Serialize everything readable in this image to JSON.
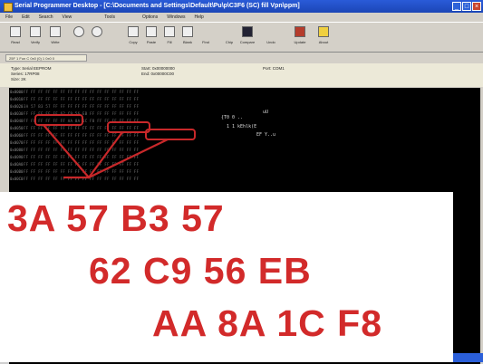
{
  "window": {
    "title": "Serial Programmer Desktop - [C:\\Documents and Settings\\Default\\Pu\\p\\C3F6 (SC) fill Vpn\\ppm]"
  },
  "menu": [
    "File",
    "Edit",
    "Search",
    "View",
    "Tools",
    "Options",
    "Windows",
    "Help"
  ],
  "toolbar": {
    "buttons": [
      "Read",
      "Verify",
      "Write",
      "Zoom",
      "Zoom",
      "Copy",
      "Paste",
      "Fill",
      "Blank",
      "Find",
      "Chip",
      "Compare",
      "Undo",
      "Update",
      "About"
    ]
  },
  "tab": {
    "label": "25F 1 Fun C 0x0 (0) 1 0x0 0"
  },
  "device": {
    "type": "Type: Serial EEPROM",
    "series": "Series: 17RP08",
    "size": "Size: 2K",
    "start": "Start: 0x00000000",
    "end": "End: 0x00000C00",
    "port": "Port: COM1"
  },
  "hex_rows": [
    {
      "addr": "0x0000",
      "bytes": "FF FF FF FF FF FF FF FF FF FF FF FF FF FF FF FF"
    },
    {
      "addr": "0x0010",
      "bytes": "FF FF FF FF FF FF FF FF FF FF FF FF FF FF FF FF"
    },
    {
      "addr": "0x0020",
      "bytes": "3A 57 B3 57 FF FF FF FF FF FF FF FF FF FF FF FF"
    },
    {
      "addr": "0x0030",
      "bytes": "FF FF FF FF FF 62 C9 56 EB FF FF FF FF FF FF FF"
    },
    {
      "addr": "0x0040",
      "bytes": "FF FF FF FF FF FF AA 8A 1C F8 FF FF FF FF FF FF"
    },
    {
      "addr": "0x0050",
      "bytes": "FF FF FF FF FF FF FF FF FF FF FF FF FF FF FF FF"
    },
    {
      "addr": "0x0060",
      "bytes": "FF FF FF FF FF FF FF FF FF FF FF FF FF FF FF FF"
    },
    {
      "addr": "0x0070",
      "bytes": "FF FF FF FF FF FF FF FF FF FF FF FF FF FF FF FF"
    },
    {
      "addr": "0x0080",
      "bytes": "FF FF FF FF FF FF FF FF FF FF FF FF FF FF FF FF"
    },
    {
      "addr": "0x0090",
      "bytes": "FF FF FF FF FF FF FF FF FF FF FF FF FF FF FF FF"
    },
    {
      "addr": "0x00A0",
      "bytes": "FF FF FF FF FF FF FF FF FF FF FF FF FF FF FF FF"
    },
    {
      "addr": "0x00B0",
      "bytes": "FF FF FF FF FF FF FF FF FF FF FF FF FF FF FF FF"
    },
    {
      "addr": "0x00C0",
      "bytes": "FF FF FF FF FF FF FF FF FF FF FF FF FF FF FF FF"
    }
  ],
  "ascii_highlights": [
    "{T0 0 ..",
    "uU",
    "1 1 kEhlk(E",
    "EF Y..u"
  ],
  "callouts": [
    "3A 57 B3 57",
    "62 C9 56 EB",
    "AA 8A 1C F8"
  ],
  "colors": {
    "accent": "#d22a2a",
    "titlebar": "#1c46b6",
    "pane": "#000000"
  }
}
